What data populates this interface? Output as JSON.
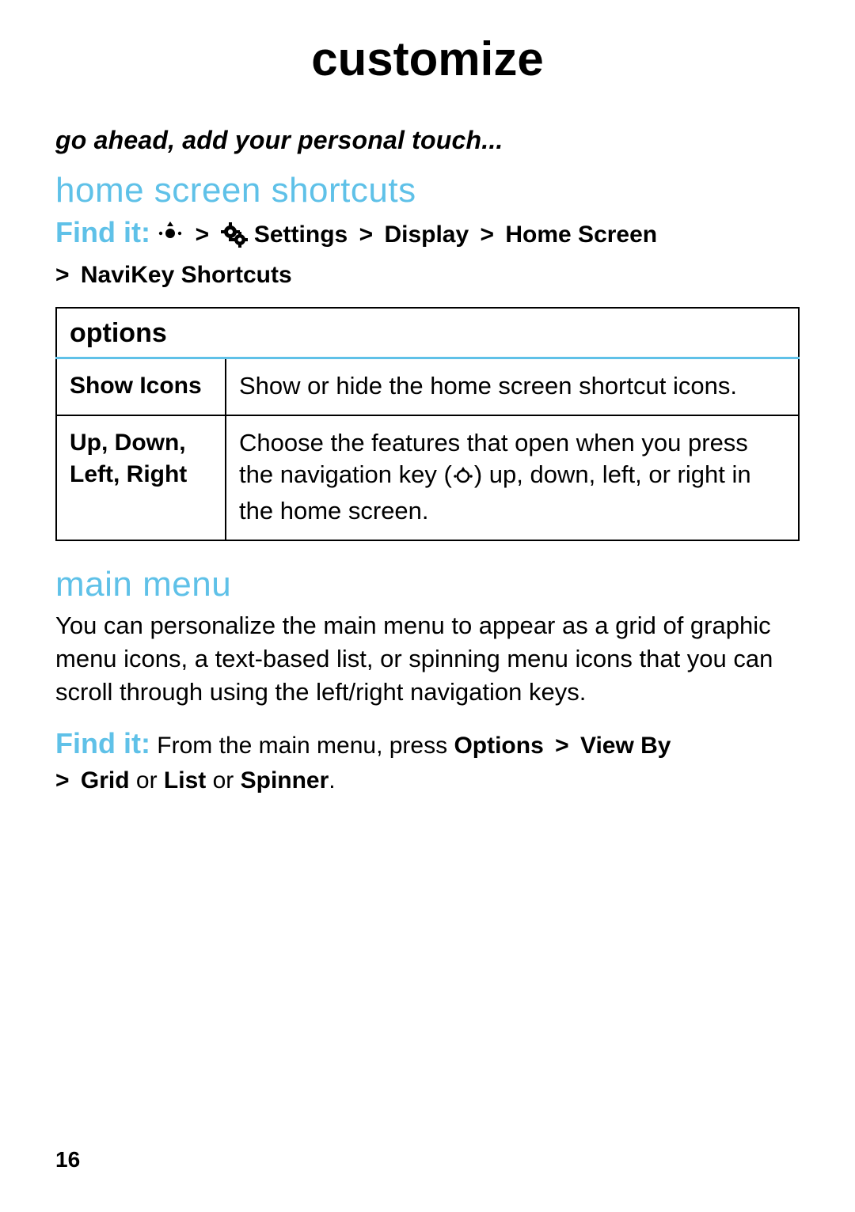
{
  "page": {
    "title": "customize",
    "subtitle": "go ahead, add your personal touch...",
    "number": "16"
  },
  "section1": {
    "heading": "home screen shortcuts",
    "findit_label": "Find it:",
    "path_settings": "Settings",
    "path_display": "Display",
    "path_home": "Home Screen",
    "path_navikey": "NaviKey Shortcuts",
    "sep": ">",
    "table_header": "options",
    "rows": [
      {
        "label": "Show Icons",
        "desc": "Show or hide the home screen shortcut icons."
      },
      {
        "label": "Up, Down, Left, Right",
        "desc_a": "Choose the features that open when you press the navigation key (",
        "desc_b": ") up, down, left, or right in the home screen."
      }
    ]
  },
  "section2": {
    "heading": "main menu",
    "para": "You can personalize the main menu to appear as a grid of graphic menu icons, a text-based list, or spinning menu icons that you can scroll through using the left/right navigation keys.",
    "findit_label": "Find it:",
    "lead": "From the main menu, press ",
    "options": "Options",
    "sep": ">",
    "viewby": "View By",
    "grid": "Grid",
    "or1": " or ",
    "list": "List",
    "or2": " or ",
    "spinner": "Spinner",
    "period": "."
  }
}
